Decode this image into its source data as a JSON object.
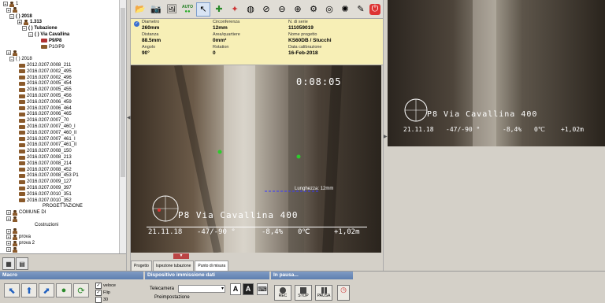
{
  "tree": {
    "nodes": [
      {
        "label": "1",
        "kind": "root",
        "bold": false
      },
      {
        "label": "",
        "kind": "person",
        "bold": false
      },
      {
        "label": "( ) 2018",
        "kind": "group",
        "bold": true
      },
      {
        "label": "1.313",
        "kind": "person",
        "bold": true
      },
      {
        "label": "( ) Tubazione",
        "kind": "group",
        "bold": true
      },
      {
        "label": "( ) Via Cavallina",
        "kind": "group",
        "bold": true
      },
      {
        "label": "P9/P8",
        "kind": "pipe-red",
        "bold": true
      },
      {
        "label": "P10/P9",
        "kind": "pipe",
        "bold": false
      },
      {
        "label": "",
        "kind": "person",
        "bold": false
      },
      {
        "label": "( ) 2018",
        "kind": "group",
        "bold": false
      },
      {
        "label": "2012.0207.0008_211",
        "kind": "pipe",
        "bold": false
      },
      {
        "label": "2016.0207.0002_495",
        "kind": "pipe",
        "bold": false
      },
      {
        "label": "2016.0207.0002_496",
        "kind": "pipe",
        "bold": false
      },
      {
        "label": "2016.0207.0005_454",
        "kind": "pipe",
        "bold": false
      },
      {
        "label": "2016.0207.0005_455",
        "kind": "pipe",
        "bold": false
      },
      {
        "label": "2016.0207.0005_456",
        "kind": "pipe",
        "bold": false
      },
      {
        "label": "2016.0207.0006_459",
        "kind": "pipe",
        "bold": false
      },
      {
        "label": "2016.0207.0006_464",
        "kind": "pipe",
        "bold": false
      },
      {
        "label": "2016.0207.0006_465",
        "kind": "pipe",
        "bold": false
      },
      {
        "label": "2016.0207.0007_70",
        "kind": "pipe",
        "bold": false
      },
      {
        "label": "2016.0207.0007_460_I",
        "kind": "pipe",
        "bold": false
      },
      {
        "label": "2016.0207.0007_460_II",
        "kind": "pipe",
        "bold": false
      },
      {
        "label": "2016.0207.0007_461_I",
        "kind": "pipe",
        "bold": false
      },
      {
        "label": "2016.0207.0007_461_II",
        "kind": "pipe",
        "bold": false
      },
      {
        "label": "2016.0207.0008_150",
        "kind": "pipe",
        "bold": false
      },
      {
        "label": "2016.0207.0008_213",
        "kind": "pipe",
        "bold": false
      },
      {
        "label": "2016.0207.0008_214",
        "kind": "pipe",
        "bold": false
      },
      {
        "label": "2016.0207.0008_452",
        "kind": "pipe",
        "bold": false
      },
      {
        "label": "2016.0207.0008_453 P1",
        "kind": "pipe",
        "bold": false
      },
      {
        "label": "2016.0207.0009_127",
        "kind": "pipe",
        "bold": false
      },
      {
        "label": "2016.0207.0009_397",
        "kind": "pipe",
        "bold": false
      },
      {
        "label": "2016.0207.0010_351",
        "kind": "pipe",
        "bold": false
      },
      {
        "label": "2016.0207.0010_352",
        "kind": "pipe",
        "bold": false
      },
      {
        "label": "PROGETTAZIONE",
        "kind": "text",
        "bold": false
      },
      {
        "label": "COMUNE DI",
        "kind": "person",
        "bold": false
      },
      {
        "label": "",
        "kind": "person",
        "bold": false
      },
      {
        "label": "Costruzioni",
        "kind": "text",
        "bold": false
      },
      {
        "label": "",
        "kind": "person",
        "bold": false
      },
      {
        "label": "prova",
        "kind": "person",
        "bold": false
      },
      {
        "label": "prova 2",
        "kind": "person",
        "bold": false
      },
      {
        "label": "",
        "kind": "person",
        "bold": false
      }
    ]
  },
  "toolbar": {
    "icons": [
      "folder-open-icon",
      "camera-icon",
      "camera-alt-icon",
      "auto-icon",
      "pointer-icon",
      "marker-icon",
      "color-icon",
      "globe-icon",
      "slash-circle-icon",
      "reticle-icon",
      "crosshair-icon",
      "gear-icon",
      "target-icon",
      "compass-icon",
      "pen-icon",
      "power-icon"
    ],
    "auto_label": "AUTO"
  },
  "info": {
    "diametro_label": "Diametro",
    "diametro": "260mm",
    "circonferenza_label": "Circonferenza",
    "circonferenza": "12mm",
    "serie_label": "N. di serie",
    "serie": "111059019",
    "distanza_label": "Distanza",
    "distanza": "88.5mm",
    "area_label": "Area/quartiere",
    "area": "0mm²",
    "progetto_label": "Nome progetto",
    "progetto": "KS60DB / Stucchi",
    "angolo_label": "Angolo",
    "angolo": "90°",
    "rotation_label": "Rotation",
    "rotation": "0",
    "calibrazione_label": "Data calibrazione",
    "calibrazione": "16-Feb-2018"
  },
  "video": {
    "timer": "0:08:05",
    "title": "P8 Via Cavallina 400",
    "date": "21.11.18",
    "angle": "-47/-90 °",
    "slope": "-8,4%",
    "temp": "0℃",
    "distance": "+1,02m",
    "measure_label": "Lunghezza: 12mm"
  },
  "right_video": {
    "title": "P8 Via Cavallina 400",
    "date": "21.11.18",
    "angle": "-47/-90 °",
    "slope": "-8,4%",
    "temp": "0℃",
    "distance": "+1,02m"
  },
  "tabs": [
    "Progetto",
    "Ispezione tubazione",
    "Punto di misura"
  ],
  "bottom": {
    "macro_title": "Macro",
    "veloce": "veloce",
    "flip": "Flip",
    "num30": "30",
    "dispositivo_title": "Dispositivo immissione dati",
    "telecamera": "Telecamera",
    "preimpostazione": "Preimpostazione",
    "pausa_title": "In pausa...",
    "rec": "REC",
    "stop": "STOP",
    "pausa": "PAUSA"
  }
}
